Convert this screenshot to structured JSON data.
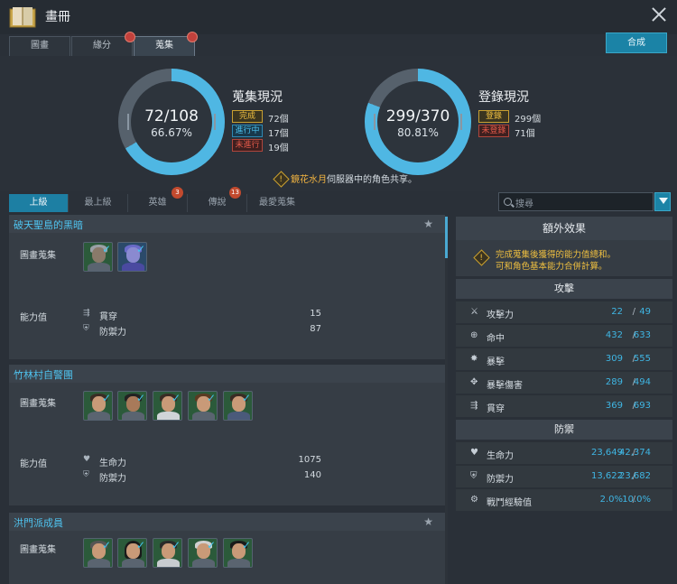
{
  "window": {
    "title": "畫冊"
  },
  "tabs": [
    "圖畫",
    "緣分",
    "蒐集"
  ],
  "actions": {
    "compose": "合成"
  },
  "collection_status": {
    "title": "蒐集現況",
    "progress": "72/108",
    "percent": "66.67%",
    "fraction": 0.6667,
    "rows": [
      {
        "badge": "完成",
        "value": "72個"
      },
      {
        "badge": "進行中",
        "value": "17個"
      },
      {
        "badge": "未進行",
        "value": "19個"
      }
    ]
  },
  "registration_status": {
    "title": "登錄現況",
    "progress": "299/370",
    "percent": "80.81%",
    "fraction": 0.8081,
    "rows": [
      {
        "badge": "登錄",
        "value": "299個"
      },
      {
        "badge": "未登錄",
        "value": "71個"
      }
    ]
  },
  "notice": {
    "highlight": "鏡花水月",
    "text": "伺服器中的角色共享。"
  },
  "filter_tabs": [
    {
      "label": "上級"
    },
    {
      "label": "最上級"
    },
    {
      "label": "英雄",
      "count": "3"
    },
    {
      "label": "傳說",
      "count": "13"
    },
    {
      "label": "最愛蒐集"
    }
  ],
  "search": {
    "placeholder": "搜尋"
  },
  "groups": [
    {
      "name": "破天聖島的黑暗",
      "collect_label": "圖畫蒐集",
      "stats_label": "能力值",
      "stats": [
        {
          "icon": "penetration-icon",
          "name": "貫穿",
          "value": "15"
        },
        {
          "icon": "defense-icon",
          "name": "防禦力",
          "value": "87"
        }
      ]
    },
    {
      "name": "竹林村自警團",
      "collect_label": "圖畫蒐集",
      "stats_label": "能力值",
      "stats": [
        {
          "icon": "heart-icon",
          "name": "生命力",
          "value": "1075"
        },
        {
          "icon": "defense-icon",
          "name": "防禦力",
          "value": "140"
        }
      ]
    },
    {
      "name": "洪門派成員",
      "collect_label": "圖畫蒐集"
    }
  ],
  "extra_effects": {
    "title": "額外效果",
    "note": [
      "完成蒐集後獲得的能力值總和。",
      "可和角色基本能力合併計算。"
    ],
    "attack": {
      "title": "攻擊",
      "rows": [
        {
          "icon": "attack-icon",
          "name": "攻擊力",
          "current": "22",
          "max": "49"
        },
        {
          "icon": "accuracy-icon",
          "name": "命中",
          "current": "432",
          "max": "633"
        },
        {
          "icon": "critical-icon",
          "name": "暴擊",
          "current": "309",
          "max": "555"
        },
        {
          "icon": "critical-damage-icon",
          "name": "暴擊傷害",
          "current": "289",
          "max": "494"
        },
        {
          "icon": "penetration-icon",
          "name": "貫穿",
          "current": "369",
          "max": "693"
        }
      ]
    },
    "defense": {
      "title": "防禦",
      "rows": [
        {
          "icon": "heart-icon",
          "name": "生命力",
          "current": "23,649",
          "max": "42,374"
        },
        {
          "icon": "defense-icon",
          "name": "防禦力",
          "current": "13,622",
          "max": "23,682"
        },
        {
          "icon": "battle-exp-icon",
          "name": "戰鬥經驗值",
          "current": "2.0%",
          "max": "10.0%"
        }
      ]
    }
  }
}
